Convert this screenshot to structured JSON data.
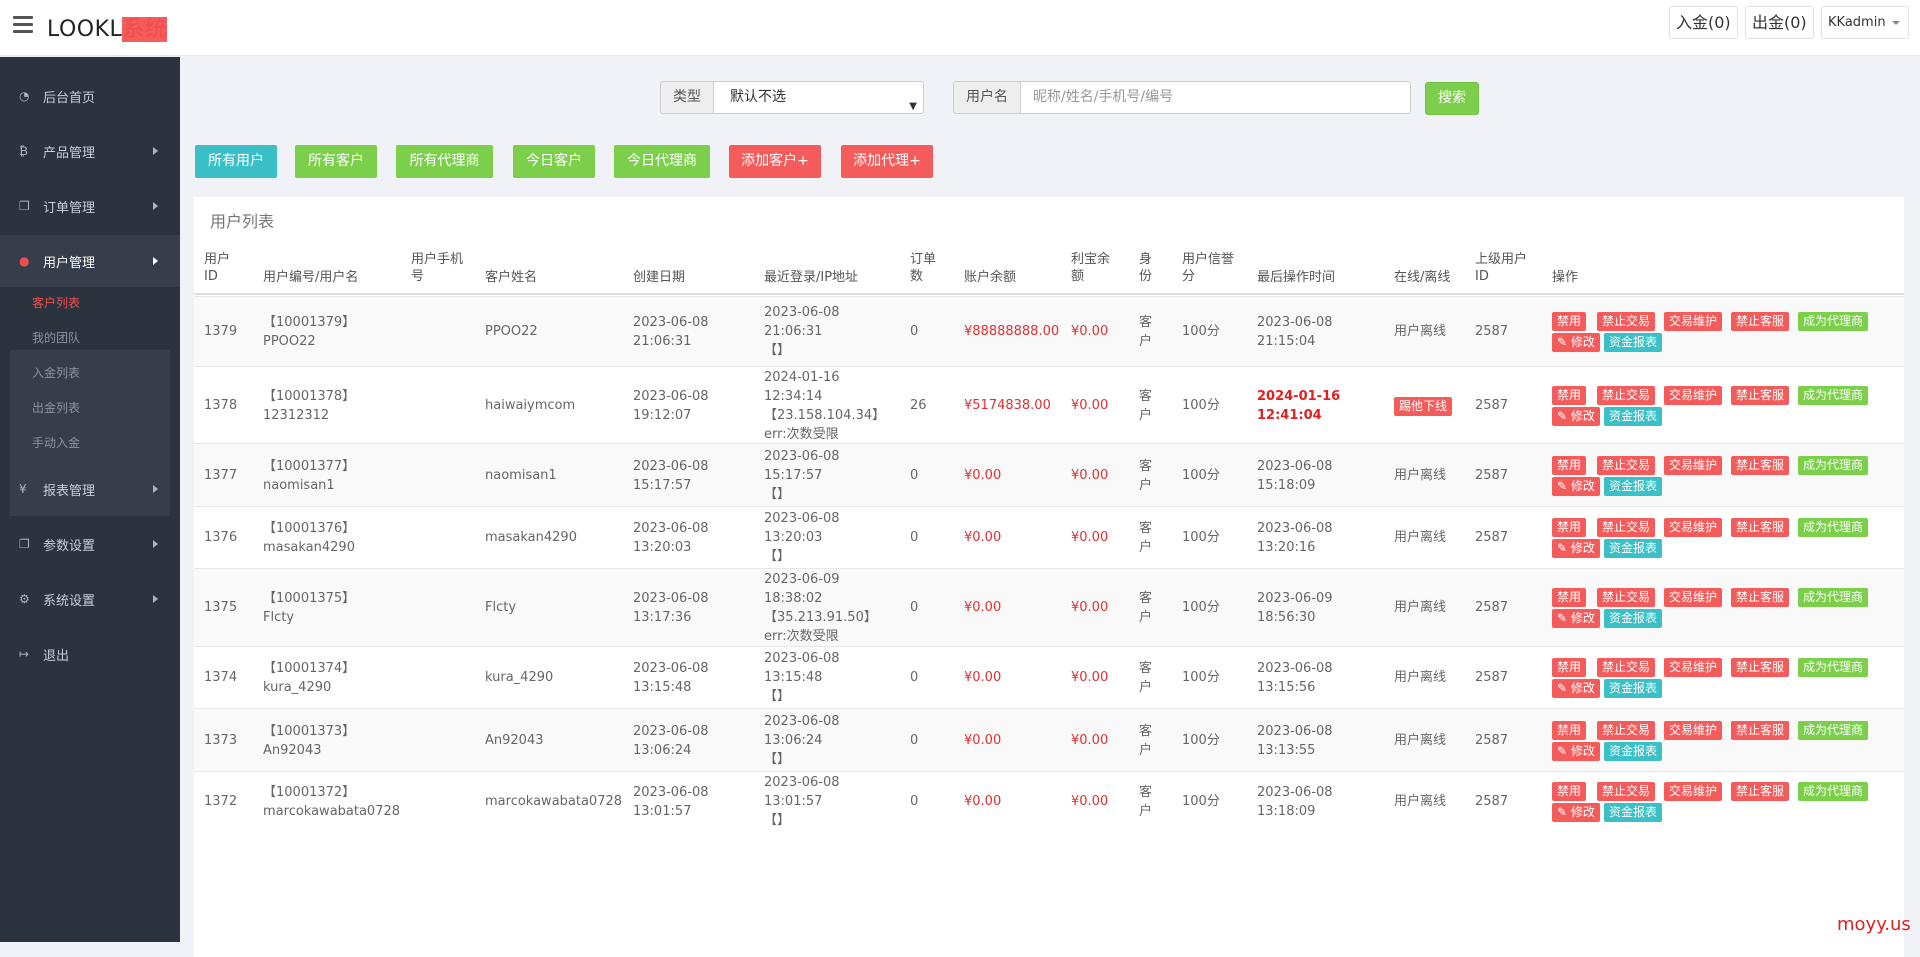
{
  "app": {
    "logo_a": "LOOKL",
    "logo_b": "系统"
  },
  "topbar": {
    "deposit": "入金(0)",
    "withdraw": "出金(0)",
    "user": "KKadmin"
  },
  "sidebar": {
    "items": [
      {
        "label": "后台首页",
        "icon": "dashboard-icon"
      },
      {
        "label": "产品管理",
        "icon": "bitcoin-icon"
      },
      {
        "label": "订单管理",
        "icon": "copy-icon"
      },
      {
        "label": "用户管理",
        "icon": "user-icon"
      },
      {
        "label": "报表管理",
        "icon": "yen-icon"
      },
      {
        "label": "参数设置",
        "icon": "copy-icon"
      },
      {
        "label": "系统设置",
        "icon": "gears-icon"
      },
      {
        "label": "退出",
        "icon": "sign-out-icon"
      }
    ],
    "sub_items": [
      "客户列表",
      "我的团队",
      "入金列表",
      "出金列表",
      "手动入金"
    ]
  },
  "filter": {
    "type_label": "类型",
    "type_value": "默认不选",
    "username_label": "用户名",
    "username_placeholder": "昵称/姓名/手机号/编号",
    "search_label": "搜索"
  },
  "filter_buttons": [
    "所有用户",
    "所有客户",
    "所有代理商",
    "今日客户",
    "今日代理商",
    "添加客户+",
    "添加代理+"
  ],
  "panel_title": "用户列表",
  "columns": {
    "id_a": "用户",
    "id_b": "ID",
    "code": "用户编号/用户名",
    "phone_a": "用户手机",
    "phone_b": "号",
    "name": "客户姓名",
    "created": "创建日期",
    "login": "最近登录/IP地址",
    "orders_a": "订单",
    "orders_b": "数",
    "balance": "账户余额",
    "yuebao_a": "利宝余",
    "yuebao_b": "额",
    "role_a": "身",
    "role_b": "份",
    "credit_a": "用户信誉",
    "credit_b": "分",
    "lastop": "最后操作时间",
    "online": "在线/离线",
    "parent_a": "上级用户",
    "parent_b": "ID",
    "ops": "操作"
  },
  "actions": {
    "ban": "禁用",
    "no_trade": "禁止交易",
    "maint": "交易维护",
    "no_cs": "禁止客服",
    "agent": "成为代理商",
    "edit": "修改",
    "report": "资金报表"
  },
  "rows": [
    {
      "id": "1379",
      "code": "【10001379】",
      "uname": "PPOO22",
      "name": "PPOO22",
      "c_date": "2023-06-08",
      "c_time": "21:06:31",
      "l_date": "2023-06-08",
      "l_time": "21:06:31",
      "l_ip": "【】",
      "l_err": "",
      "orders": "0",
      "balance": "¥88888888.00",
      "yuebao": "¥0.00",
      "role_a": "客",
      "role_b": "户",
      "credit": "100分",
      "op_date": "2023-06-08",
      "op_time": "21:15:04",
      "online": "用户离线",
      "parent": "2587"
    },
    {
      "id": "1378",
      "code": "【10001378】",
      "uname": "12312312",
      "name": "haiwaiymcom",
      "c_date": "2023-06-08",
      "c_time": "19:12:07",
      "l_date": "2024-01-16",
      "l_time": "12:34:14",
      "l_ip": "【23.158.104.34】",
      "l_err": "err:次数受限",
      "orders": "26",
      "balance": "¥5174838.00",
      "yuebao": "¥0.00",
      "role_a": "客",
      "role_b": "户",
      "credit": "100分",
      "op_date": "2024-01-16",
      "op_time": "12:41:04",
      "online": "踢他下线",
      "parent": "2587"
    },
    {
      "id": "1377",
      "code": "【10001377】",
      "uname": "naomisan1",
      "name": "naomisan1",
      "c_date": "2023-06-08",
      "c_time": "15:17:57",
      "l_date": "2023-06-08",
      "l_time": "15:17:57",
      "l_ip": "【】",
      "l_err": "",
      "orders": "0",
      "balance": "¥0.00",
      "yuebao": "¥0.00",
      "role_a": "客",
      "role_b": "户",
      "credit": "100分",
      "op_date": "2023-06-08",
      "op_time": "15:18:09",
      "online": "用户离线",
      "parent": "2587"
    },
    {
      "id": "1376",
      "code": "【10001376】",
      "uname": "masakan4290",
      "name": "masakan4290",
      "c_date": "2023-06-08",
      "c_time": "13:20:03",
      "l_date": "2023-06-08",
      "l_time": "13:20:03",
      "l_ip": "【】",
      "l_err": "",
      "orders": "0",
      "balance": "¥0.00",
      "yuebao": "¥0.00",
      "role_a": "客",
      "role_b": "户",
      "credit": "100分",
      "op_date": "2023-06-08",
      "op_time": "13:20:16",
      "online": "用户离线",
      "parent": "2587"
    },
    {
      "id": "1375",
      "code": "【10001375】",
      "uname": "Flcty",
      "name": "Flcty",
      "c_date": "2023-06-08",
      "c_time": "13:17:36",
      "l_date": "2023-06-09",
      "l_time": "18:38:02",
      "l_ip": "【35.213.91.50】",
      "l_err": "err:次数受限",
      "orders": "0",
      "balance": "¥0.00",
      "yuebao": "¥0.00",
      "role_a": "客",
      "role_b": "户",
      "credit": "100分",
      "op_date": "2023-06-09",
      "op_time": "18:56:30",
      "online": "用户离线",
      "parent": "2587"
    },
    {
      "id": "1374",
      "code": "【10001374】",
      "uname": "kura_4290",
      "name": "kura_4290",
      "c_date": "2023-06-08",
      "c_time": "13:15:48",
      "l_date": "2023-06-08",
      "l_time": "13:15:48",
      "l_ip": "【】",
      "l_err": "",
      "orders": "0",
      "balance": "¥0.00",
      "yuebao": "¥0.00",
      "role_a": "客",
      "role_b": "户",
      "credit": "100分",
      "op_date": "2023-06-08",
      "op_time": "13:15:56",
      "online": "用户离线",
      "parent": "2587"
    },
    {
      "id": "1373",
      "code": "【10001373】",
      "uname": "An92043",
      "name": "An92043",
      "c_date": "2023-06-08",
      "c_time": "13:06:24",
      "l_date": "2023-06-08",
      "l_time": "13:06:24",
      "l_ip": "【】",
      "l_err": "",
      "orders": "0",
      "balance": "¥0.00",
      "yuebao": "¥0.00",
      "role_a": "客",
      "role_b": "户",
      "credit": "100分",
      "op_date": "2023-06-08",
      "op_time": "13:13:55",
      "online": "用户离线",
      "parent": "2587"
    },
    {
      "id": "1372",
      "code": "【10001372】",
      "uname": "marcokawabata0728",
      "name": "marcokawabata0728",
      "c_date": "2023-06-08",
      "c_time": "13:01:57",
      "l_date": "2023-06-08",
      "l_time": "13:01:57",
      "l_ip": "【】",
      "l_err": "",
      "orders": "0",
      "balance": "¥0.00",
      "yuebao": "¥0.00",
      "role_a": "客",
      "role_b": "户",
      "credit": "100分",
      "op_date": "2023-06-08",
      "op_time": "13:18:09",
      "online": "用户离线",
      "parent": "2587"
    }
  ],
  "watermark": "moyy.us"
}
